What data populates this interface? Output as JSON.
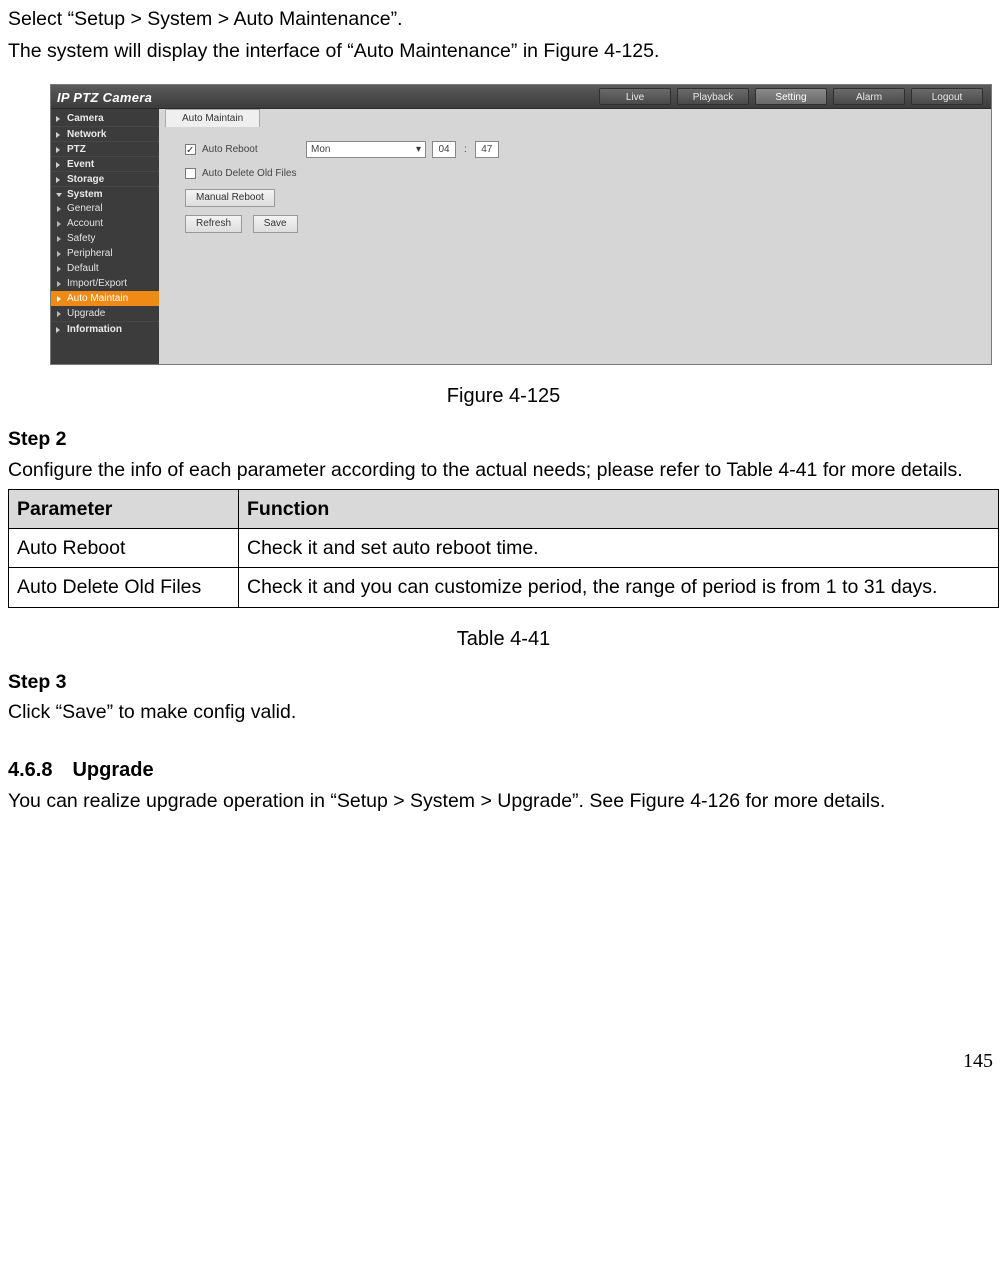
{
  "intro1": "Select “Setup > System > Auto Maintenance”.",
  "intro2": "The system will display the interface of “Auto Maintenance” in Figure 4-125.",
  "figure_caption": "Figure 4-125",
  "step2_head": "Step 2",
  "step2_body": "Configure the info of each parameter according to the actual needs; please refer to Table 4-41 for more details.",
  "param_table": {
    "headers": [
      "Parameter",
      "Function"
    ],
    "rows": [
      {
        "param": "Auto Reboot",
        "func": "Check it and set auto reboot time."
      },
      {
        "param": "Auto Delete Old Files",
        "func": "Check it and you can customize period, the range of period is from 1 to 31 days."
      }
    ]
  },
  "table_caption": "Table 4-41",
  "step3_head": "Step 3",
  "step3_body": "Click “Save” to make config valid.",
  "section_head": "4.6.8 Upgrade",
  "section_body": "You can realize upgrade operation in “Setup > System > Upgrade”. See Figure 4-126 for more details.",
  "page_number": "145",
  "shot": {
    "logo": "IP PTZ Camera",
    "tabs": {
      "live": "Live",
      "playback": "Playback",
      "setting": "Setting",
      "alarm": "Alarm",
      "logout": "Logout"
    },
    "help_icon": "?",
    "sidebar": {
      "camera": "Camera",
      "network": "Network",
      "ptz": "PTZ",
      "event": "Event",
      "storage": "Storage",
      "system": "System",
      "general": "General",
      "account": "Account",
      "safety": "Safety",
      "peripheral": "Peripheral",
      "default": "Default",
      "import_export": "Import/Export",
      "auto_maintain": "Auto Maintain",
      "upgrade": "Upgrade",
      "information": "Information"
    },
    "content_tab": "Auto Maintain",
    "form": {
      "auto_reboot_label": "Auto Reboot",
      "auto_delete_label": "Auto Delete Old Files",
      "day_value": "Mon",
      "hour_value": "04",
      "minute_value": "47",
      "time_sep": ":",
      "manual_reboot": "Manual Reboot",
      "refresh": "Refresh",
      "save": "Save"
    }
  }
}
